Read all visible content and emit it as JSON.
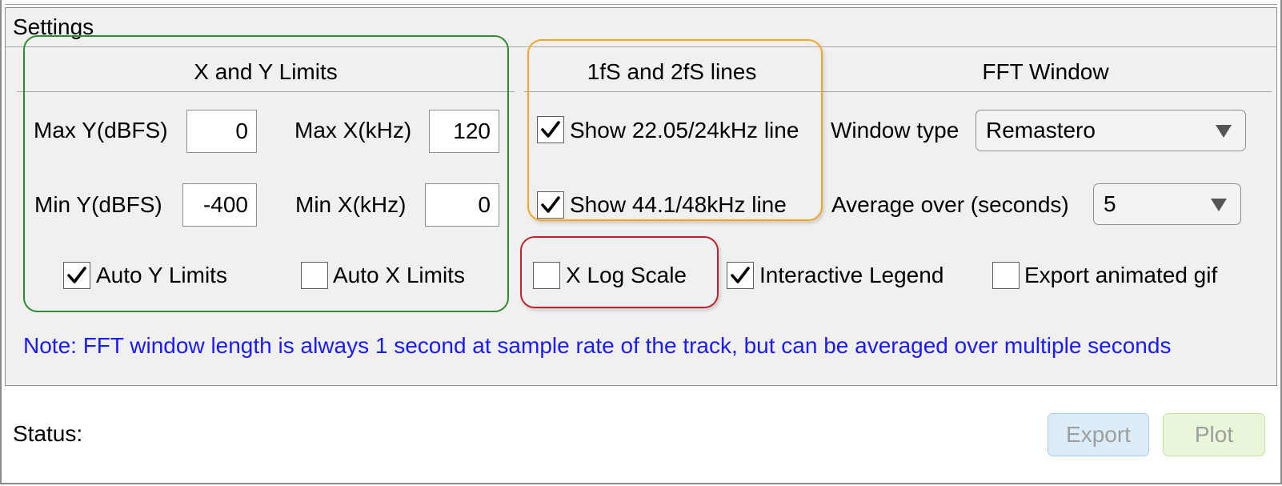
{
  "settings": {
    "title": "Settings",
    "xy_limits": {
      "title": "X and Y Limits",
      "max_y_label": "Max Y(dBFS)",
      "max_y_value": "0",
      "max_x_label": "Max X(kHz)",
      "max_x_value": "120",
      "min_y_label": "Min Y(dBFS)",
      "min_y_value": "-400",
      "min_x_label": "Min X(kHz)",
      "min_x_value": "0",
      "auto_y_label": "Auto  Y Limits",
      "auto_y_checked": true,
      "auto_x_label": "Auto X Limits",
      "auto_x_checked": false
    },
    "lines": {
      "title": "1fS and 2fS lines",
      "show_1fs_label": "Show 22.05/24kHz line",
      "show_1fs_checked": true,
      "show_2fs_label": "Show 44.1/48kHz line",
      "show_2fs_checked": true
    },
    "fft": {
      "title": "FFT Window",
      "window_type_label": "Window type",
      "window_type_value": "Remastero",
      "average_label": "Average over (seconds)",
      "average_value": "5"
    },
    "x_log_label": "X Log Scale",
    "x_log_checked": false,
    "legend_label": "Interactive Legend",
    "legend_checked": true,
    "gif_label": "Export animated gif",
    "gif_checked": false,
    "note": "Note: FFT window length is always 1 second at sample rate of the track, but can be averaged over multiple seconds"
  },
  "status": {
    "label": "Status:"
  },
  "buttons": {
    "export": "Export",
    "plot": "Plot"
  },
  "colors": {
    "note": "#1a1aff",
    "highlight_green": "#2e8b2e",
    "highlight_orange": "#f5a623",
    "highlight_red": "#c0212b"
  }
}
